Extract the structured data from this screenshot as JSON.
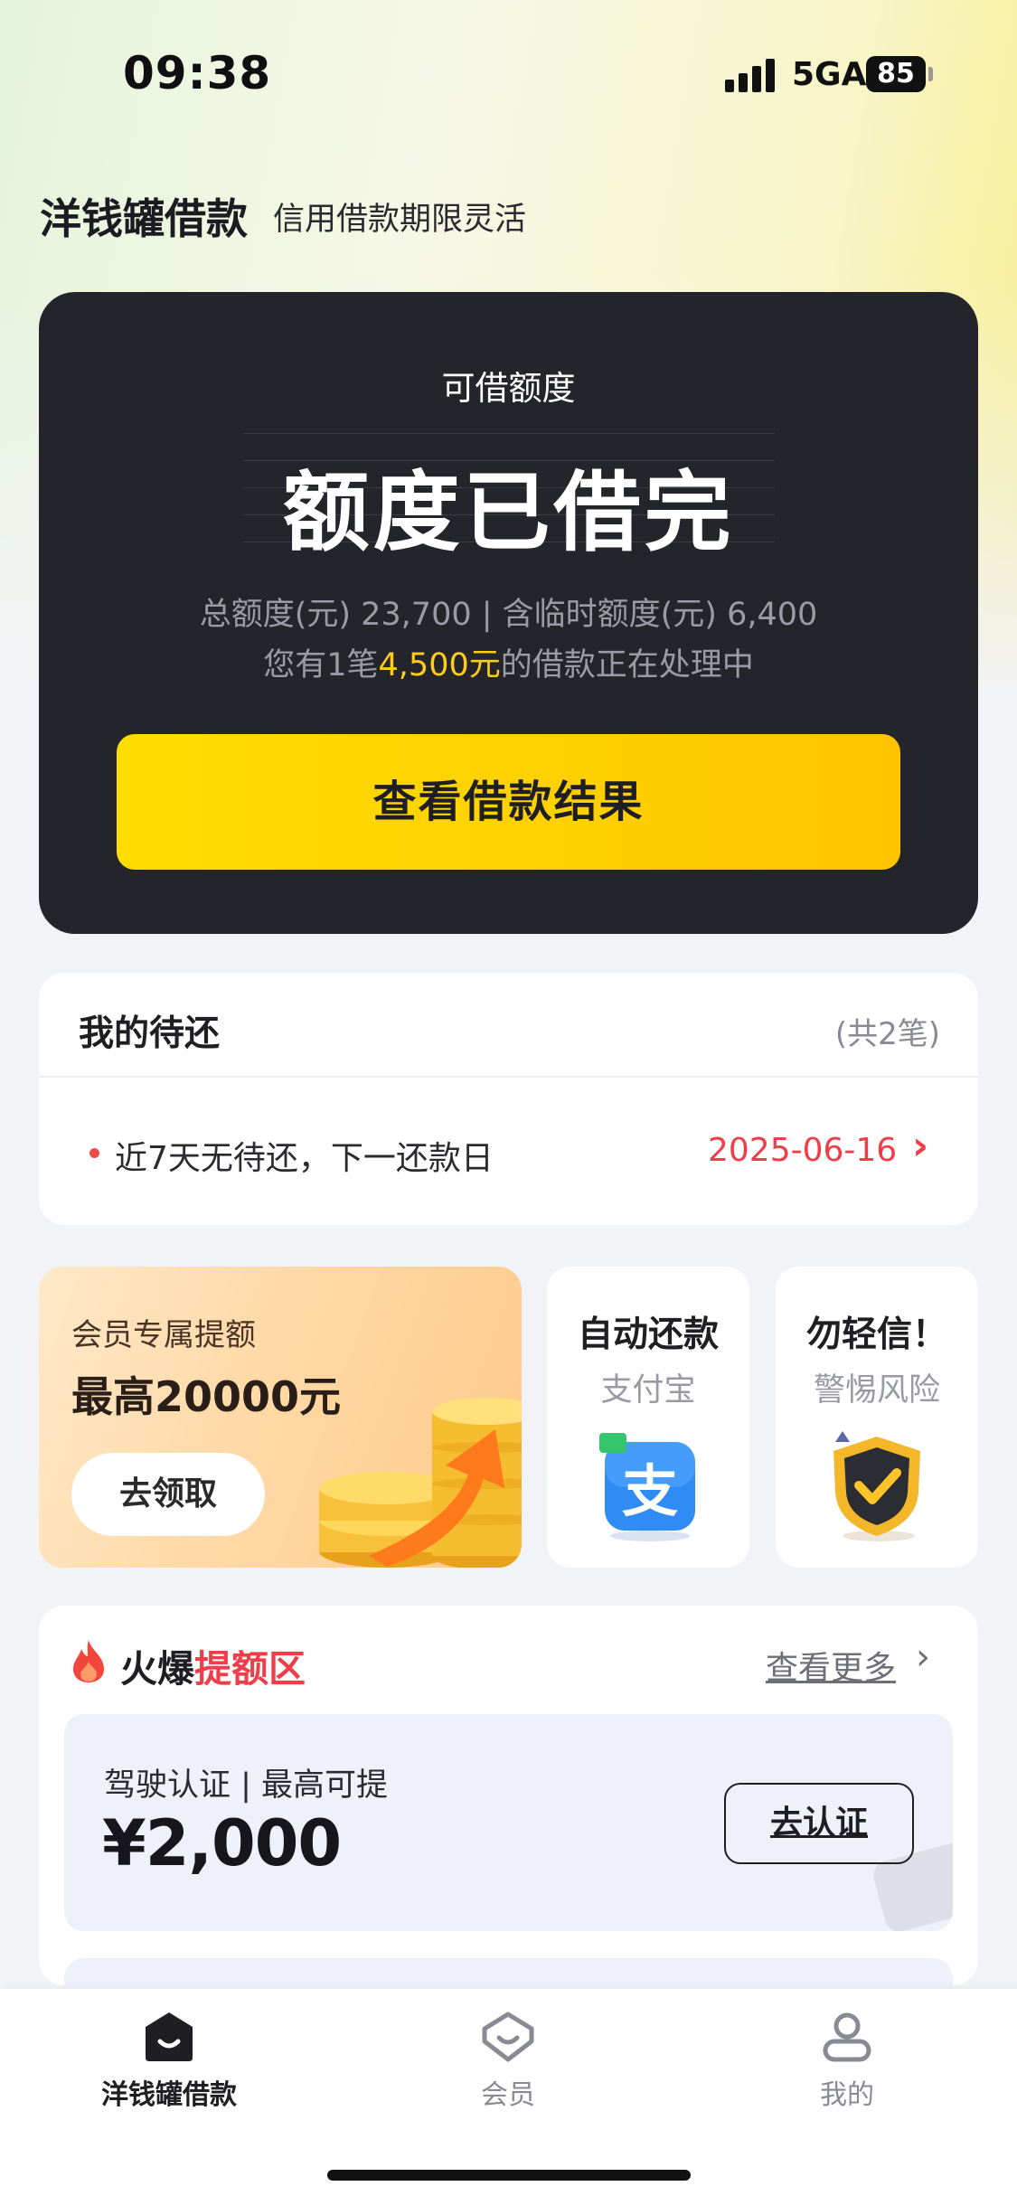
{
  "status_bar": {
    "time": "09:38",
    "network": "5GA",
    "battery": "85"
  },
  "header": {
    "title": "洋钱罐借款",
    "subtitle": "信用借款期限灵活"
  },
  "credit_card": {
    "label": "可借额度",
    "status": "额度已借完",
    "total_line": "总额度(元) 23,700 | 含临时额度(元) 6,400",
    "pending_prefix": "您有1笔",
    "pending_amount": "4,500元",
    "pending_suffix": "的借款正在处理中",
    "button": "查看借款结果",
    "accent": "#ffcc1c"
  },
  "pending": {
    "title": "我的待还",
    "count": "(共2笔)",
    "text": "近7天无待还，下一还款日",
    "date": "2025-06-16",
    "date_color": "#ef3e4a"
  },
  "promo": {
    "member": {
      "label": "会员专属提额",
      "amount": "最高20000元",
      "button": "去领取"
    },
    "autopay": {
      "title": "自动还款",
      "subtitle": "支付宝",
      "icon": "alipay-icon",
      "glyph": "支"
    },
    "risk": {
      "title": "勿轻信！",
      "subtitle": "警惕风险",
      "icon": "shield-check-icon"
    }
  },
  "hot_zone": {
    "title_prefix": "火爆",
    "title_highlight": "提额区",
    "more": "查看更多",
    "offer": {
      "label": "驾驶认证 | 最高可提",
      "amount": "¥2,000",
      "button": "去认证"
    }
  },
  "tab_bar": {
    "items": [
      {
        "label": "洋钱罐借款",
        "icon": "home-icon",
        "active": true
      },
      {
        "label": "会员",
        "icon": "member-icon",
        "active": false
      },
      {
        "label": "我的",
        "icon": "profile-icon",
        "active": false
      }
    ]
  }
}
